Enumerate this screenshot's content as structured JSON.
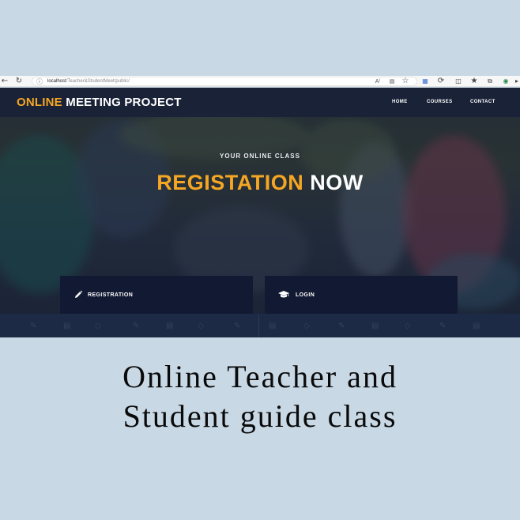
{
  "browser": {
    "back_icon": "arrow-left-icon",
    "reload_icon": "reload-icon",
    "info_icon": "info-icon",
    "url_host": "localhost",
    "url_path": "/Teacher&StudentMeet/public/",
    "toolbar_icons": [
      "read-aloud-icon",
      "immersive-reader-icon",
      "favorite-star-icon",
      "translate-icon",
      "refresh-app-icon",
      "split-screen-icon",
      "favorites-icon",
      "collections-icon",
      "copilot-icon",
      "sidebar-icon"
    ]
  },
  "site": {
    "brand": {
      "accent": "ONLINE",
      "rest": "MEETING PROJECT"
    },
    "nav": {
      "home": "HOME",
      "courses": "COURSES",
      "contact": "CONTACT"
    },
    "hero": {
      "eyebrow": "YOUR ONLINE CLASS",
      "headline_accent": "REGISTATION",
      "headline_white": "NOW"
    },
    "cards": {
      "registration": {
        "label": "REGISTRATION",
        "icon": "pencil-icon"
      },
      "login": {
        "label": "LOGIN",
        "icon": "graduation-cap-icon"
      }
    }
  },
  "caption": {
    "line1": "Online Teacher and",
    "line2": "Student guide class"
  },
  "colors": {
    "accent": "#f5a623",
    "navbar": "#1a2238",
    "card": "#121a33",
    "background": "#c8d8e5"
  }
}
